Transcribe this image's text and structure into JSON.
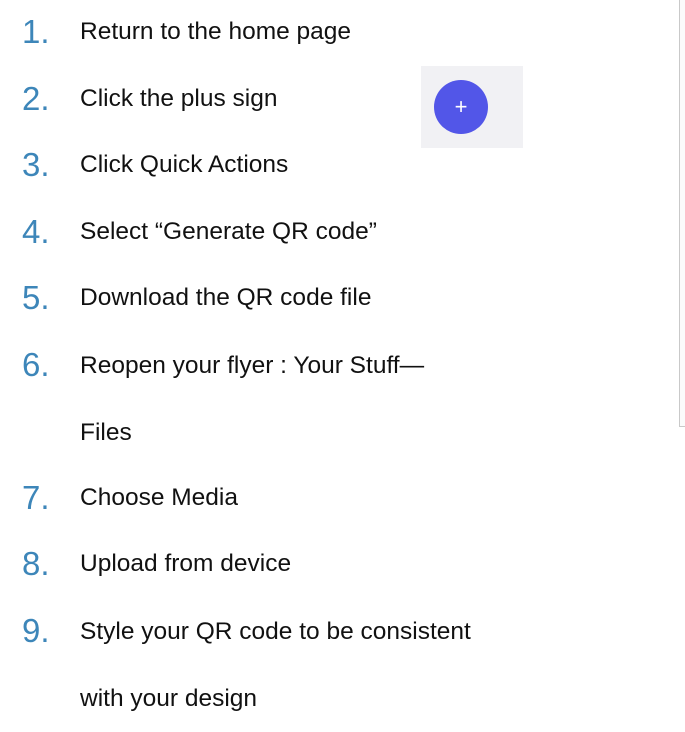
{
  "steps": [
    {
      "number": "1.",
      "text": "Return to the home page"
    },
    {
      "number": "2.",
      "text": "Click the  plus sign"
    },
    {
      "number": "3.",
      "text": "Click Quick Actions"
    },
    {
      "number": "4.",
      "text": "Select “Generate QR code”"
    },
    {
      "number": "5.",
      "text": "Download the QR code file"
    },
    {
      "number": "6.",
      "line1": "Reopen your flyer : Your Stuff—",
      "line2": "Files"
    },
    {
      "number": "7.",
      "text": "Choose Media"
    },
    {
      "number": "8.",
      "text": "Upload from device"
    },
    {
      "number": "9.",
      "line1": "Style your QR code to be consistent",
      "line2": "with your design"
    }
  ],
  "plus_button": {
    "glyph": "+",
    "icon": "plus-icon",
    "color": "#5256e8"
  },
  "colors": {
    "number": "#3d86b9",
    "text": "#111111"
  }
}
